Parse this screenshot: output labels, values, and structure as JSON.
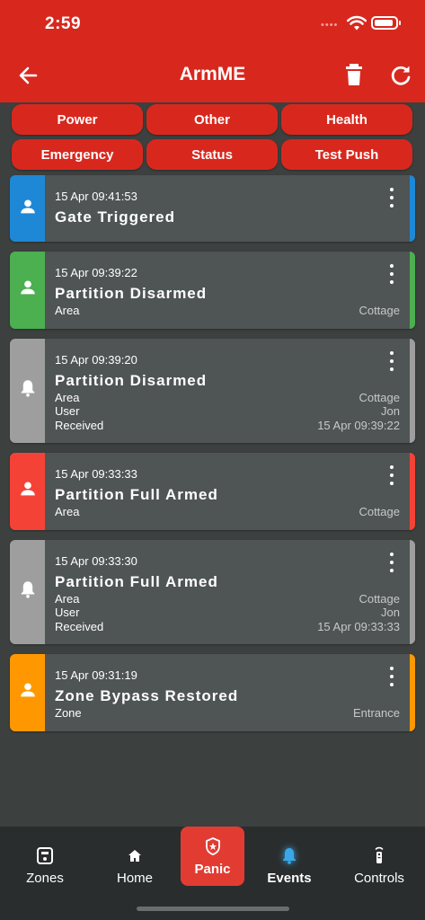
{
  "status_bar": {
    "time": "2:59",
    "dots": "••••"
  },
  "header": {
    "title": "ArmME",
    "back_icon": "back-arrow-icon",
    "delete_icon": "trash-icon",
    "refresh_icon": "refresh-icon",
    "color": "#d8281e"
  },
  "filters": [
    "Power",
    "Other",
    "Health",
    "Emergency",
    "Status",
    "Test Push"
  ],
  "events": [
    {
      "time": "15 Apr 09:41:53",
      "title": "Gate Triggered",
      "icon": "person-icon",
      "color": "#1e88d6",
      "rows": []
    },
    {
      "time": "15 Apr 09:39:22",
      "title": "Partition Disarmed",
      "icon": "person-icon",
      "color": "#4caf50",
      "rows": [
        {
          "label": "Area",
          "value": "Cottage"
        }
      ]
    },
    {
      "time": "15 Apr 09:39:20",
      "title": "Partition Disarmed",
      "icon": "bell-icon",
      "color": "#9e9e9e",
      "rows": [
        {
          "label": "Area",
          "value": "Cottage"
        },
        {
          "label": "User",
          "value": "Jon"
        },
        {
          "label": "Received",
          "value": "15 Apr 09:39:22"
        }
      ]
    },
    {
      "time": "15 Apr 09:33:33",
      "title": "Partition Full Armed",
      "icon": "person-icon",
      "color": "#f44336",
      "rows": [
        {
          "label": "Area",
          "value": "Cottage"
        }
      ]
    },
    {
      "time": "15 Apr 09:33:30",
      "title": "Partition Full Armed",
      "icon": "bell-icon",
      "color": "#9e9e9e",
      "rows": [
        {
          "label": "Area",
          "value": "Cottage"
        },
        {
          "label": "User",
          "value": "Jon"
        },
        {
          "label": "Received",
          "value": "15 Apr 09:33:33"
        }
      ]
    },
    {
      "time": "15 Apr 09:31:19",
      "title": "Zone Bypass Restored",
      "icon": "person-icon",
      "color": "#ff9800",
      "rows": [
        {
          "label": "Zone",
          "value": "Entrance"
        }
      ]
    }
  ],
  "nav": {
    "zones": "Zones",
    "home": "Home",
    "panic": "Panic",
    "events": "Events",
    "controls": "Controls",
    "active": "events",
    "active_color": "#3aa8e8",
    "panic_color": "#e23c32"
  }
}
